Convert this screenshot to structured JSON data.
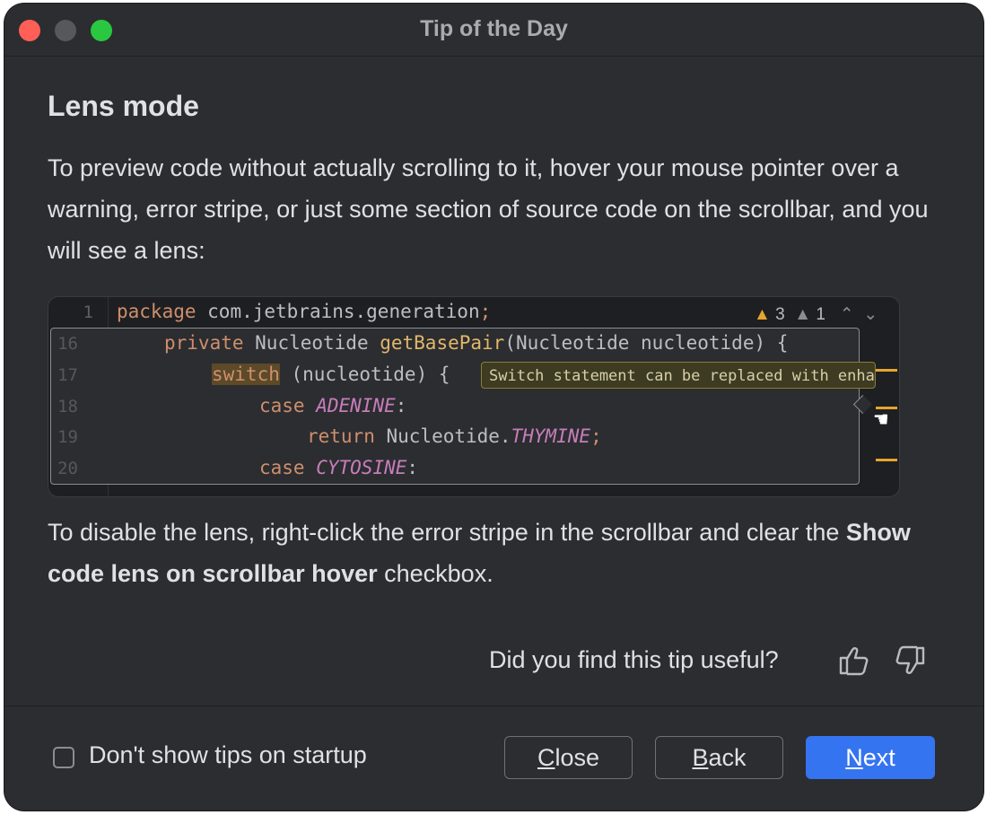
{
  "window": {
    "title": "Tip of the Day"
  },
  "tip": {
    "heading": "Lens mode",
    "intro": "To preview code without actually scrolling to it, hover your mouse pointer over a warning, error stripe, or just some section of source code on the scrollbar, and you will see a lens:",
    "outro_before": "To disable the lens, right-click the error stripe in the scrollbar and clear the ",
    "outro_bold": "Show code lens on scrollbar hover",
    "outro_after": " checkbox."
  },
  "code": {
    "line1_num": "1",
    "line1_kw": "package",
    "line1_rest": " com.jetbrains.generation",
    "line1_semi": ";",
    "inspection": {
      "warnings": "3",
      "weak_warnings": "1"
    },
    "lens_lines": [
      {
        "num": "16"
      },
      {
        "num": "17"
      },
      {
        "num": "18"
      },
      {
        "num": "19"
      },
      {
        "num": "20"
      }
    ],
    "l16": {
      "kw": "private",
      "type": " Nucleotide ",
      "fn": "getBasePair",
      "rest": "(Nucleotide nucleotide) {"
    },
    "l17": {
      "kw": "switch",
      "rest": " (nucleotide) {"
    },
    "l18": {
      "kw": "case",
      "sp": " ",
      "it": "ADENINE",
      "rest": ":"
    },
    "l19": {
      "kw": "return",
      "rest": " Nucleotide.",
      "it": "THYMINE",
      "semi": ";"
    },
    "l20": {
      "kw": "case",
      "sp": " ",
      "it": "CYTOSINE",
      "rest": ":"
    },
    "tooltip": "Switch statement can be replaced with enhanced 'switch'"
  },
  "feedback": {
    "question": "Did you find this tip useful?"
  },
  "footer": {
    "checkbox_label": "Don't show tips on startup",
    "close": {
      "mnemonic": "C",
      "rest": "lose"
    },
    "back": {
      "mnemonic": "B",
      "rest": "ack"
    },
    "next": {
      "mnemonic": "N",
      "rest": "ext"
    }
  },
  "colors": {
    "accent": "#3574f0",
    "warning": "#e6a52e",
    "background": "#2b2d30"
  }
}
